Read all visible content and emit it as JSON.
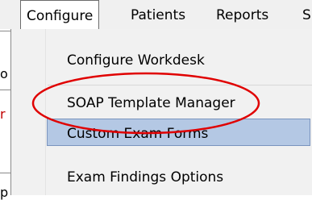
{
  "menubar": {
    "items": [
      {
        "label": "Configure"
      },
      {
        "label": "Patients"
      },
      {
        "label": "Reports"
      },
      {
        "label": "S"
      }
    ]
  },
  "left_fragments": [
    "o",
    "r",
    "p"
  ],
  "dropdown": {
    "items": [
      {
        "label": "Configure Workdesk"
      },
      {
        "label": "SOAP Template Manager"
      },
      {
        "label": "Custom Exam Forms"
      },
      {
        "label": "Exam Findings Options"
      }
    ]
  },
  "colors": {
    "highlight": "#b4c8e4",
    "annotation_circle": "#e00000"
  }
}
